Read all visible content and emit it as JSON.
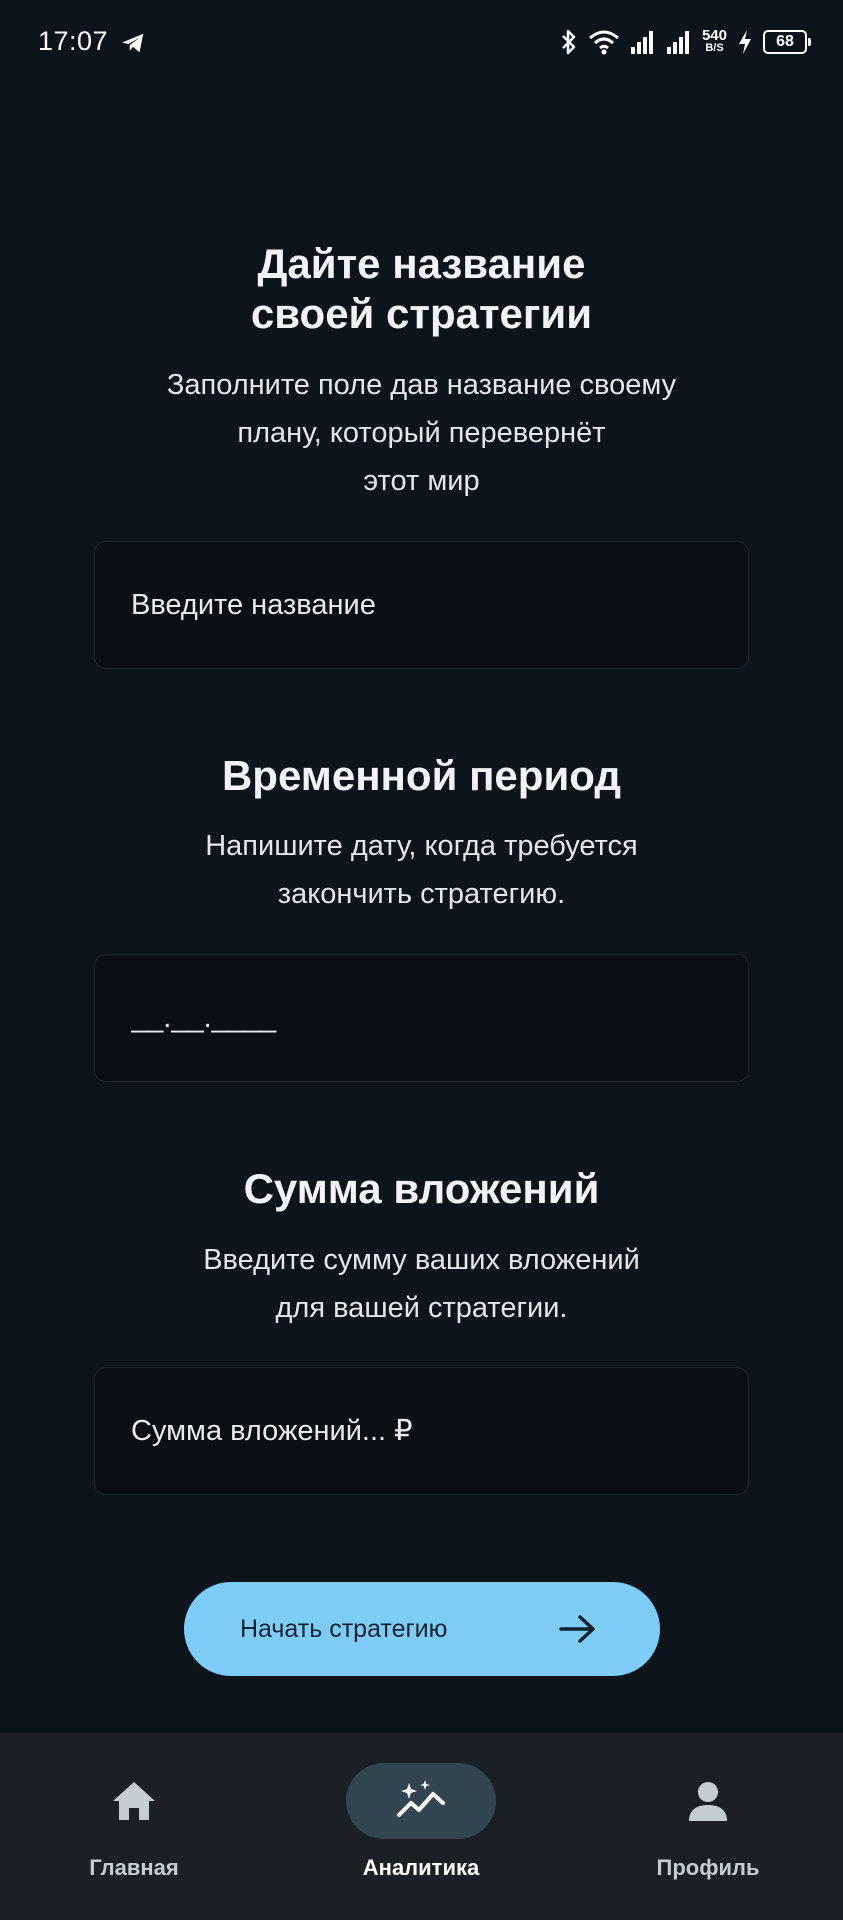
{
  "status_bar": {
    "time": "17:07",
    "net_speed_value": "540",
    "net_speed_unit": "B/S",
    "battery": "68",
    "icons": [
      "telegram-icon",
      "bluetooth-icon",
      "wifi-icon",
      "signal-icon",
      "signal-icon",
      "charging-icon",
      "battery-icon"
    ]
  },
  "name_section": {
    "title_line1": "Дайте название",
    "title_line2": "своей стратегии",
    "sub_line1": "Заполните поле дав название своему",
    "sub_line2": "плану, который перевернёт",
    "sub_line3": "этот мир",
    "input_placeholder": "Введите название",
    "input_value": ""
  },
  "period_section": {
    "title": "Временной период",
    "sub_line1": "Напишите дату, когда требуется",
    "sub_line2": "закончить стратегию.",
    "input_placeholder": "__.__.____",
    "input_value": ""
  },
  "amount_section": {
    "title": "Сумма вложений",
    "sub_line1": "Введите сумму ваших вложений",
    "sub_line2": "для вашей стратегии.",
    "input_placeholder": "Сумма вложений... ₽",
    "input_value": ""
  },
  "start_button": {
    "label": "Начать стратегию",
    "icon": "arrow-right-icon"
  },
  "bottom_nav": {
    "items": [
      {
        "label": "Главная",
        "icon": "home-icon",
        "active": false
      },
      {
        "label": "Аналитика",
        "icon": "sparkle-chart-icon",
        "active": true
      },
      {
        "label": "Профиль",
        "icon": "person-icon",
        "active": false
      }
    ]
  },
  "colors": {
    "background": "#0e141b",
    "accent": "#7dcdf8",
    "nav_background": "#1b2027",
    "nav_active_pill": "#344552"
  }
}
